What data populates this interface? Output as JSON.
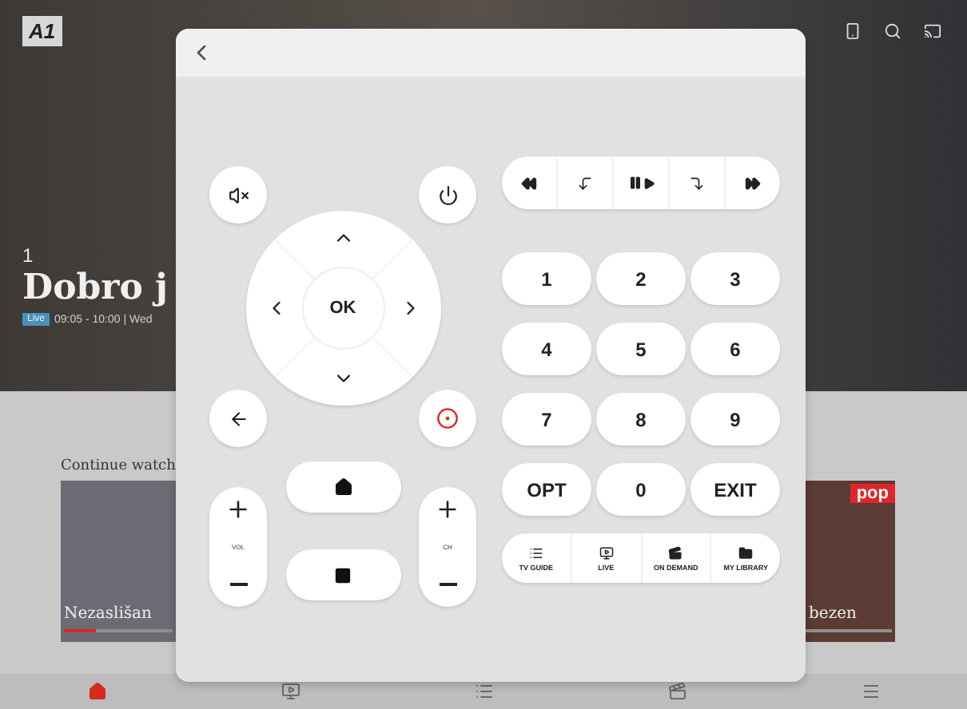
{
  "background": {
    "logo": "A1",
    "channel_number": "1",
    "show_title": "Dobro j",
    "live_badge": "Live",
    "time": "09:05 - 10:00 | Wed",
    "section_title": "Continue watch",
    "cards": [
      {
        "title": "Nezaslišan",
        "level": 0.3
      },
      {
        "title": "bezen",
        "channel_logo": "pop"
      }
    ],
    "bottom_nav": [
      {
        "kind": "home",
        "selected": true
      },
      {
        "kind": "live",
        "selected": false
      },
      {
        "kind": "guide",
        "selected": false
      },
      {
        "kind": "demand",
        "selected": false
      },
      {
        "kind": "more",
        "selected": false
      }
    ]
  },
  "remote": {
    "ok_label": "OK",
    "volume_label": "VOL",
    "channel_label": "CH",
    "number_keys": [
      "1",
      "2",
      "3",
      "4",
      "5",
      "6",
      "7",
      "8",
      "9",
      "OPT",
      "0",
      "EXIT"
    ],
    "shortcuts": [
      {
        "kind": "guide",
        "label": "TV GUIDE"
      },
      {
        "kind": "live",
        "label": "LIVE"
      },
      {
        "kind": "demand",
        "label": "ON DEMAND"
      },
      {
        "kind": "library",
        "label": "MY LIBRARY"
      }
    ]
  }
}
